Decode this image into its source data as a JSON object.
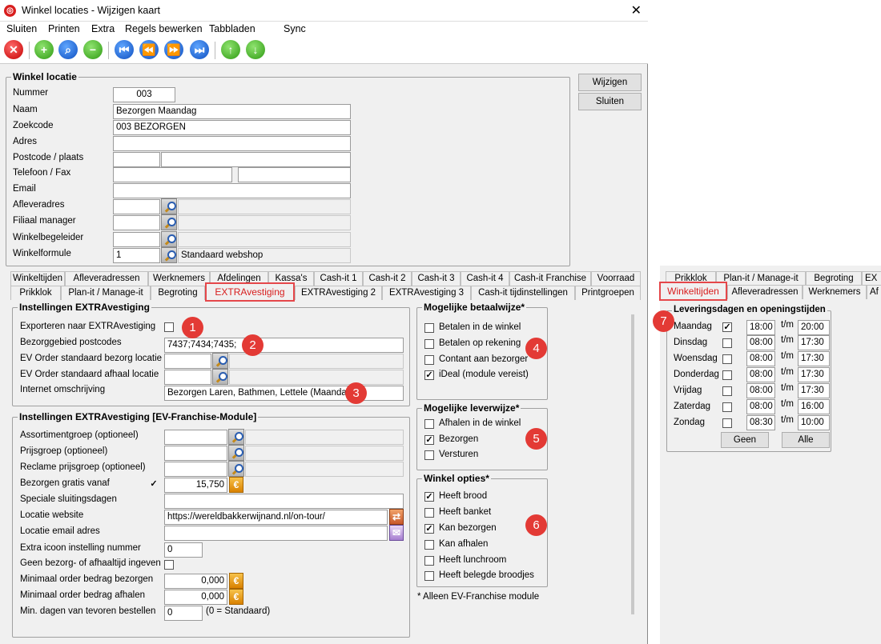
{
  "window": {
    "title": "Winkel locaties - Wijzigen kaart",
    "close": "✕"
  },
  "menu": [
    "Sluiten",
    "Printen",
    "Extra",
    "Regels bewerken",
    "Tabbladen",
    "Sync"
  ],
  "toolbar": {
    "buttons": [
      "close",
      "add",
      "search",
      "remove",
      "first",
      "prev",
      "next",
      "last",
      "up",
      "down"
    ]
  },
  "actions": {
    "edit": "Wijzigen",
    "close": "Sluiten"
  },
  "location": {
    "group": "Winkel locatie",
    "fields": {
      "number": {
        "label": "Nummer",
        "value": "003"
      },
      "name": {
        "label": "Naam",
        "value": "Bezorgen Maandag"
      },
      "searchcode": {
        "label": "Zoekcode",
        "value": "003 BEZORGEN"
      },
      "address": {
        "label": "Adres",
        "value": ""
      },
      "postcode": {
        "label": "Postcode / plaats",
        "value": ""
      },
      "phone": {
        "label": "Telefoon / Fax",
        "value": ""
      },
      "email": {
        "label": "Email",
        "value": ""
      },
      "delivery_address": {
        "label": "Afleveradres",
        "value": ""
      },
      "branch_manager": {
        "label": "Filiaal manager",
        "value": ""
      },
      "store_coach": {
        "label": "Winkelbegeleider",
        "value": ""
      },
      "store_formula": {
        "label": "Winkelformule",
        "value": "1",
        "desc": "Standaard webshop"
      }
    }
  },
  "tabs_row1": [
    "Winkeltijden",
    "Afleveradressen",
    "Werknemers",
    "Afdelingen",
    "Kassa's",
    "Cash-it 1",
    "Cash-it 2",
    "Cash-it 3",
    "Cash-it 4",
    "Cash-it Franchise",
    "Voorraad"
  ],
  "tabs_row2": [
    "Prikklok",
    "Plan-it / Manage-it",
    "Begroting",
    "EXTRAvestiging",
    "EXTRAvestiging 2",
    "EXTRAvestiging 3",
    "Cash-it tijdinstellingen",
    "Printgroepen"
  ],
  "extra": {
    "group": "Instellingen EXTRAvestiging",
    "export_label": "Exporteren naar EXTRAvestiging",
    "postcodes_label": "Bezorggebied postcodes",
    "postcodes_value": "7437;7434;7435;",
    "order_delivery_label": "EV Order standaard bezorg locatie",
    "order_pickup_label": "EV Order standaard afhaal locatie",
    "internet_label": "Internet omschrijving",
    "internet_value": "Bezorgen Laren, Bathmen, Lettele (Maandag)"
  },
  "franchise": {
    "group": "Instellingen EXTRAvestiging [EV-Franchise-Module]",
    "assortment": "Assortimentgroep (optioneel)",
    "price_group": "Prijsgroep (optioneel)",
    "promo_group": "Reclame prijsgroep (optioneel)",
    "free_delivery": "Bezorgen gratis vanaf",
    "free_delivery_value": "15,750",
    "closing_days": "Speciale sluitingsdagen",
    "website": "Locatie website",
    "website_value": "https://wereldbakkerwijnand.nl/on-tour/",
    "email": "Locatie email adres",
    "icon_number": "Extra icoon instelling nummer",
    "icon_number_value": "0",
    "no_time": "Geen bezorg- of afhaaltijd ingeven",
    "min_delivery": "Minimaal order bedrag bezorgen",
    "min_delivery_value": "0,000",
    "min_pickup": "Minimaal order bedrag afhalen",
    "min_pickup_value": "0,000",
    "min_days": "Min. dagen van tevoren bestellen",
    "min_days_value": "0",
    "min_days_hint": "(0 = Standaard)"
  },
  "payment": {
    "group": "Mogelijke betaalwijze*",
    "options": [
      {
        "label": "Betalen in de winkel",
        "checked": false
      },
      {
        "label": "Betalen op rekening",
        "checked": false
      },
      {
        "label": "Contant aan bezorger",
        "checked": false
      },
      {
        "label": "iDeal (module vereist)",
        "checked": true
      }
    ]
  },
  "delivery": {
    "group": "Mogelijke leverwijze*",
    "options": [
      {
        "label": "Afhalen in de winkel",
        "checked": false
      },
      {
        "label": "Bezorgen",
        "checked": true
      },
      {
        "label": "Versturen",
        "checked": false
      }
    ]
  },
  "store_options": {
    "group": "Winkel opties*",
    "options": [
      {
        "label": "Heeft brood",
        "checked": true
      },
      {
        "label": "Heeft banket",
        "checked": false
      },
      {
        "label": "Kan bezorgen",
        "checked": true
      },
      {
        "label": "Kan afhalen",
        "checked": false
      },
      {
        "label": "Heeft lunchroom",
        "checked": false
      },
      {
        "label": "Heeft belegde broodjes",
        "checked": false
      }
    ]
  },
  "footnote": "* Alleen EV-Franchise module",
  "right_tabs_row1": [
    "Prikklok",
    "Plan-it / Manage-it",
    "Begroting",
    "EX"
  ],
  "right_tabs_row2": [
    "Winkeltijden",
    "Afleveradressen",
    "Werknemers",
    "Af"
  ],
  "hours": {
    "group": "Leveringsdagen en openingstijden",
    "to": "t/m",
    "days": [
      {
        "day": "Maandag",
        "checked": true,
        "from": "18:00",
        "to": "20:00"
      },
      {
        "day": "Dinsdag",
        "checked": false,
        "from": "08:00",
        "to": "17:30"
      },
      {
        "day": "Woensdag",
        "checked": false,
        "from": "08:00",
        "to": "17:30"
      },
      {
        "day": "Donderdag",
        "checked": false,
        "from": "08:00",
        "to": "17:30"
      },
      {
        "day": "Vrijdag",
        "checked": false,
        "from": "08:00",
        "to": "17:30"
      },
      {
        "day": "Zaterdag",
        "checked": false,
        "from": "08:00",
        "to": "16:00"
      },
      {
        "day": "Zondag",
        "checked": false,
        "from": "08:30",
        "to": "10:00"
      }
    ],
    "none_button": "Geen",
    "all_button": "Alle"
  },
  "badges": [
    "1",
    "2",
    "3",
    "4",
    "5",
    "6",
    "7"
  ],
  "colors": {
    "accent": "#e5474a",
    "badge": "#e33a35"
  }
}
